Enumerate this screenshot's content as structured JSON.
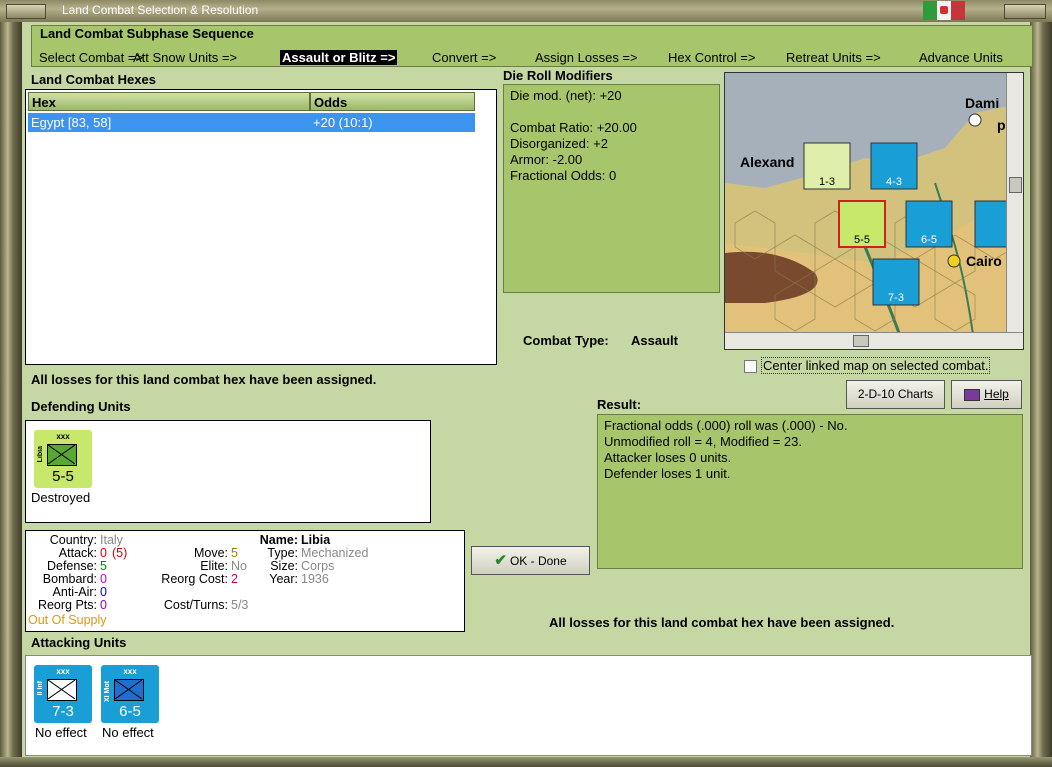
{
  "window": {
    "title": "Land Combat Selection & Resolution"
  },
  "subphase": {
    "heading": "Land Combat Subphase Sequence",
    "steps": [
      "Select Combat =>",
      "Att Snow Units =>",
      "Assault or Blitz =>",
      "Convert =>",
      "Assign Losses =>",
      "Hex Control =>",
      "Retreat Units =>",
      "Advance Units"
    ],
    "selected_index": 2
  },
  "hexes": {
    "heading": "Land Combat Hexes",
    "columns": [
      "Hex",
      "Odds"
    ],
    "rows": [
      {
        "hex": "Egypt [83, 58]",
        "odds": "+20 (10:1)"
      }
    ]
  },
  "modifiers": {
    "heading": "Die Roll Modifiers",
    "lines": [
      "Die mod. (net): +20",
      "",
      "Combat Ratio: +20.00",
      "Disorganized: +2",
      "Armor: -2.00",
      "Fractional Odds: 0"
    ]
  },
  "map": {
    "labels": {
      "alexandria": "Alexand",
      "damietta": "Dami",
      "cairo": "Cairo",
      "p": "p"
    },
    "center_label": "Center linked map on selected combat."
  },
  "combat_type": {
    "label": "Combat Type:",
    "value": "Assault"
  },
  "status_msg_1": "All losses for this land combat hex have been assigned.",
  "buttons": {
    "charts": "2-D-10 Charts",
    "help": "Help",
    "ok": "OK - Done"
  },
  "defending": {
    "heading": "Defending Units",
    "units": [
      {
        "size": "xxx",
        "name": "Libia",
        "value": "5-5",
        "status": "Destroyed"
      }
    ]
  },
  "result": {
    "heading": "Result:",
    "lines": [
      "Fractional odds (.000) roll was (.000)  - No.",
      "Unmodified roll = 4, Modified = 23.",
      "Attacker loses 0 units.",
      "Defender loses 1 unit."
    ]
  },
  "details": {
    "country_label": "Country:",
    "country": "Italy",
    "attack_label": "Attack:",
    "attack": "0",
    "attack_paren": "(5)",
    "defense_label": "Defense:",
    "defense": "5",
    "bombard_label": "Bombard:",
    "bombard": "0",
    "antiair_label": "Anti-Air:",
    "antiair": "0",
    "reorg_pts_label": "Reorg Pts:",
    "reorg_pts": "0",
    "supply": "Out Of Supply",
    "move_label": "Move:",
    "move": "5",
    "elite_label": "Elite:",
    "elite": "No",
    "reorg_cost_label": "Reorg Cost:",
    "reorg_cost": "2",
    "cost_turns_label": "Cost/Turns:",
    "cost_turns": "5/3",
    "name_label": "Name:",
    "name": "Libia",
    "type_label": "Type:",
    "type": "Mechanized",
    "size_label": "Size:",
    "size": "Corps",
    "year_label": "Year:",
    "year": "1936"
  },
  "status_msg_2": "All losses for this land combat hex have been assigned.",
  "attacking": {
    "heading": "Attacking Units",
    "units": [
      {
        "size": "xxx",
        "name": "II Inf",
        "value": "7-3",
        "status": "No effect"
      },
      {
        "size": "xxx",
        "name": "XI Mot",
        "value": "6-5",
        "status": "No effect"
      }
    ]
  },
  "colors": {
    "counter_green": "#c7e86b",
    "counter_blue": "#199ed6",
    "selection": "#3d94f0"
  }
}
